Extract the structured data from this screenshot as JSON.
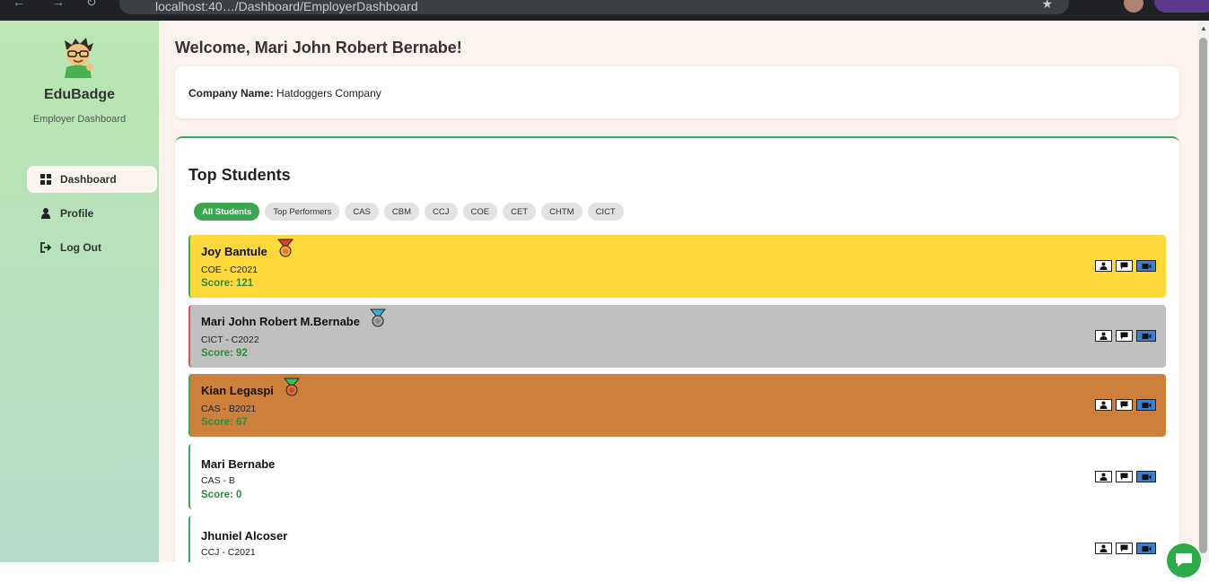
{
  "browser": {
    "url": "localhost:40…/Dashboard/EmployerDashboard"
  },
  "sidebar": {
    "brand": "EduBadge",
    "subtitle": "Employer Dashboard",
    "items": [
      {
        "label": "Dashboard",
        "icon": "grid-icon",
        "active": true
      },
      {
        "label": "Profile",
        "icon": "user-icon",
        "active": false
      },
      {
        "label": "Log Out",
        "icon": "logout-icon",
        "active": false
      }
    ]
  },
  "main": {
    "welcome": "Welcome, Mari John Robert Bernabe!",
    "company_label": "Company Name:",
    "company_value": "Hatdoggers Company",
    "top_title": "Top Students",
    "filters": [
      "All Students",
      "Top Performers",
      "CAS",
      "CBM",
      "CCJ",
      "COE",
      "CET",
      "CHTM",
      "CICT"
    ],
    "active_filter": "All Students",
    "students": [
      {
        "name": "Joy Bantule",
        "dept": "COE - C2021",
        "score": "Score: 121",
        "medal": "gold-medal-icon",
        "bg": "#fdd93c",
        "border": "#3daa5a"
      },
      {
        "name": "Mari John Robert M.Bernabe",
        "dept": "CICT - C2022",
        "score": "Score: 92",
        "medal": "silver-medal-icon",
        "bg": "#c0c0c0",
        "border": "#e05050"
      },
      {
        "name": "Kian Legaspi",
        "dept": "CAS - B2021",
        "score": "Score: 67",
        "medal": "bronze-medal-icon",
        "bg": "#cd7f3c",
        "border": "#3daa5a"
      },
      {
        "name": "Mari Bernabe",
        "dept": "CAS - B",
        "score": "Score: 0",
        "medal": "",
        "bg": "#ffffff",
        "border": "#3daa5a"
      },
      {
        "name": "Jhuniel Alcoser",
        "dept": "CCJ - C2021",
        "score": "",
        "medal": "",
        "bg": "#ffffff",
        "border": "#3daa5a"
      }
    ]
  },
  "colors": {
    "accent": "#3daa5a",
    "gold": "#fdd93c",
    "silver": "#c0c0c0",
    "bronze": "#cd7f3c",
    "score_text": "#2e8b3c",
    "sidebar_top": "#b9e6b1",
    "main_bg": "#fdf3ee"
  }
}
